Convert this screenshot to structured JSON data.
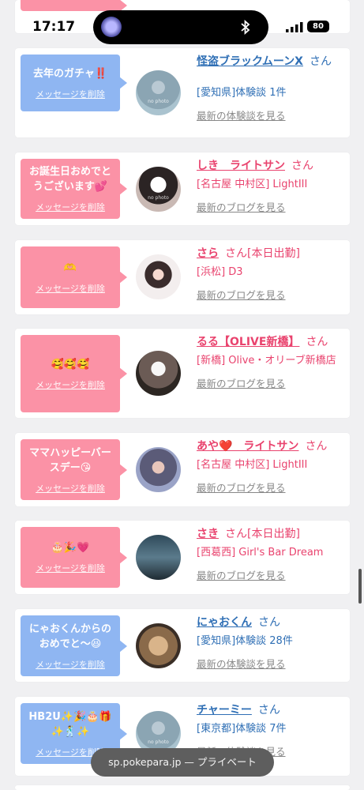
{
  "status_bar": {
    "time": "17:17",
    "battery": "80"
  },
  "url_bar": {
    "text": "sp.pokepara.jp — プライベート"
  },
  "colors": {
    "pink_bubble": "#fb92a6",
    "blue_bubble": "#8fb6f2",
    "pink_text": "#e9436e",
    "blue_text": "#2f6fb5"
  },
  "cards": [
    {
      "message": "去年のガチャ‼️",
      "delete_label": "メッセージを削除",
      "avatar_label": "no photo",
      "name": "怪盗ブラックムーンX",
      "san": "さん",
      "status": "",
      "detail": "[愛知県]体験談 1件",
      "link": "最新の体験談を見る"
    },
    {
      "message": "お誕生日おめでとうございます💕",
      "delete_label": "メッセージを削除",
      "avatar_label": "no photo",
      "name": "しき　ライトサン",
      "san": "さん",
      "status": "",
      "detail": "[名古屋 中村区] LightIII",
      "link": "最新のブログを見る"
    },
    {
      "message": "🫶",
      "delete_label": "メッセージを削除",
      "avatar_label": "",
      "name": "さら",
      "san": "さん",
      "status": "[本日出勤]",
      "detail": "[浜松] D3",
      "link": "最新のブログを見る"
    },
    {
      "message": "🥰🥰🥰",
      "delete_label": "メッセージを削除",
      "avatar_label": "",
      "name": "るる【OLIVE新橋】",
      "san": "さん",
      "status": "",
      "detail": "[新橋] Olive・オリーブ新橋店",
      "link": "最新のブログを見る"
    },
    {
      "message": "ママハッピーバースデー😘",
      "delete_label": "メッセージを削除",
      "avatar_label": "",
      "name": "あや❤️　ライトサン",
      "san": "さん",
      "status": "",
      "detail": "[名古屋 中村区] LightIII",
      "link": "最新のブログを見る"
    },
    {
      "message": "🎂🎉💗",
      "delete_label": "メッセージを削除",
      "avatar_label": "",
      "name": "さき",
      "san": "さん",
      "status": "[本日出勤]",
      "detail": "[西葛西] Girl's Bar Dream",
      "link": "最新のブログを見る"
    },
    {
      "message": "にゃおくんからのおめでと〜😆",
      "delete_label": "メッセージを削除",
      "avatar_label": "",
      "name": "にゃおくん",
      "san": "さん",
      "status": "",
      "detail": "[愛知県]体験談 28件",
      "link": "最新の体験談を見る"
    },
    {
      "message": "HB2U✨🎉🎂🎁✨🕺✨",
      "delete_label": "メッセージを削除",
      "avatar_label": "no photo",
      "name": "チャーミー",
      "san": "さん",
      "status": "",
      "detail": "[東京都]体験談 7件",
      "link": "最新の体験談を見る"
    }
  ]
}
